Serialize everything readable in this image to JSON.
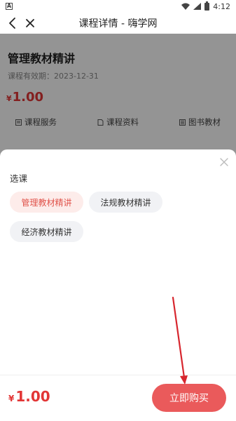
{
  "status_bar": {
    "time": "4:12",
    "left_icon": "A"
  },
  "header": {
    "title": "课程详情 - 嗨学网"
  },
  "course": {
    "title": "管理教材精讲",
    "validity": "课程有效期：2023-12-31",
    "price_symbol": "¥",
    "price": "1.00",
    "services": [
      {
        "label": "课程服务",
        "icon": "document-icon"
      },
      {
        "label": "课程资料",
        "icon": "file-icon"
      },
      {
        "label": "图书教材",
        "icon": "book-icon"
      }
    ]
  },
  "sheet": {
    "title": "选课",
    "options": [
      {
        "label": "管理教材精讲",
        "selected": true
      },
      {
        "label": "法规教材精讲",
        "selected": false
      },
      {
        "label": "经济教材精讲",
        "selected": false
      }
    ],
    "price_symbol": "¥",
    "price": "1.00",
    "buy_label": "立即购买"
  },
  "colors": {
    "accent": "#ea5a5b",
    "price": "#e23636",
    "chip_selected_bg": "#fdecea",
    "chip_bg": "#f1f2f5"
  }
}
